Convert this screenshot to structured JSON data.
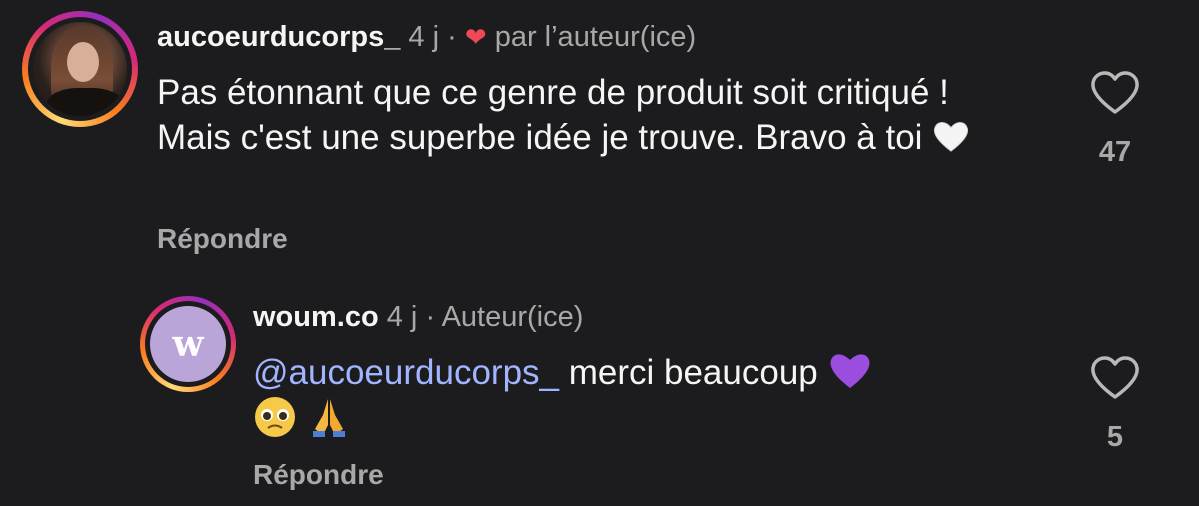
{
  "comments": [
    {
      "username": "aucoeurducorps_",
      "time": "4 j",
      "separator": "·",
      "tag": "par l’auteur(ice)",
      "text": "Pas étonnant que ce genre de produit soit critiqué ! Mais c'est une superbe idée je trouve. Bravo à toi",
      "text_emoji": "white-heart",
      "reply_label": "Répondre",
      "like_count": "47",
      "liked_by_author": true
    },
    {
      "username": "woum.co",
      "time": "4 j",
      "separator": "·",
      "tag": "Auteur(ice)",
      "avatar_letter": "w",
      "mention": "@aucoeurducorps_",
      "text": " merci beaucoup",
      "text_emoji": [
        "purple-heart",
        "pleading-face",
        "folded-hands"
      ],
      "reply_label": "Répondre",
      "like_count": "5"
    }
  ],
  "colors": {
    "background": "#1c1c1e",
    "text": "#f5f5f5",
    "muted": "#a8a8a8",
    "mention": "#a0b4ff",
    "liked_heart": "#ed4956",
    "logo_avatar": "#b9a5d8"
  }
}
